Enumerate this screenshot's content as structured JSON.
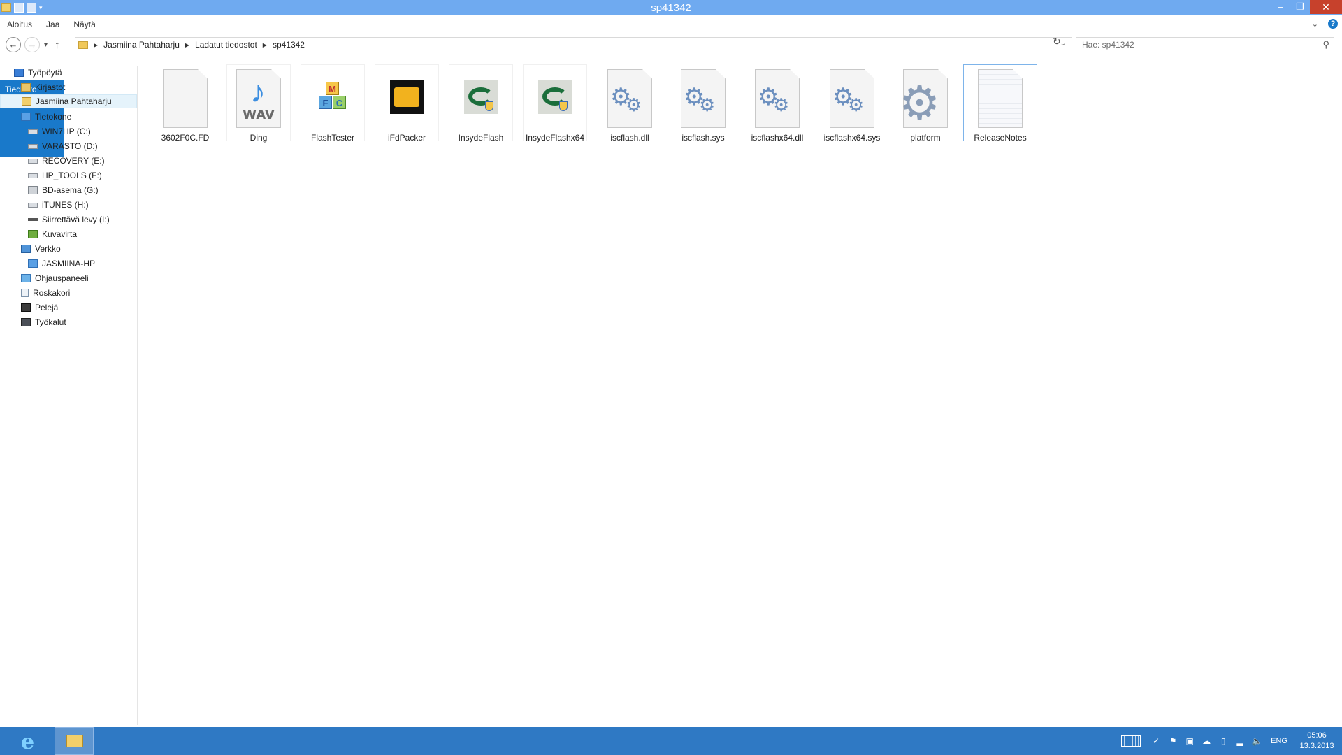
{
  "window": {
    "title": "sp41342"
  },
  "ribbon": {
    "tabs": [
      "Tiedosto",
      "Aloitus",
      "Jaa",
      "Näytä"
    ]
  },
  "address": {
    "crumbs": [
      "Jasmiina Pahtaharju",
      "Ladatut tiedostot",
      "sp41342"
    ]
  },
  "search": {
    "placeholder": "Hae: sp41342"
  },
  "navpane": {
    "items": [
      {
        "label": "Työpöytä",
        "icon": "desktop-icon"
      },
      {
        "label": "Kirjastot",
        "icon": "libraries-icon"
      },
      {
        "label": "Jasmiina Pahtaharju",
        "icon": "user-folder-icon",
        "selected": true
      },
      {
        "label": "Tietokone",
        "icon": "computer-icon"
      },
      {
        "label": "WIN7HP (C:)",
        "icon": "drive-icon"
      },
      {
        "label": "VARASTO (D:)",
        "icon": "drive-icon"
      },
      {
        "label": "RECOVERY (E:)",
        "icon": "drive-icon"
      },
      {
        "label": "HP_TOOLS (F:)",
        "icon": "drive-icon"
      },
      {
        "label": "BD-asema (G:)",
        "icon": "bd-drive-icon"
      },
      {
        "label": "iTUNES (H:)",
        "icon": "drive-icon"
      },
      {
        "label": "Siirrettävä levy (I:)",
        "icon": "removable-drive-icon"
      },
      {
        "label": "Kuvavirta",
        "icon": "photo-stream-icon"
      },
      {
        "label": "Verkko",
        "icon": "network-icon"
      },
      {
        "label": "JASMIINA-HP",
        "icon": "computer-icon"
      },
      {
        "label": "Ohjauspaneeli",
        "icon": "control-panel-icon"
      },
      {
        "label": "Roskakori",
        "icon": "recycle-bin-icon"
      },
      {
        "label": "Pelejä",
        "icon": "games-icon"
      },
      {
        "label": "Työkalut",
        "icon": "tools-icon"
      }
    ]
  },
  "files": [
    {
      "name": "3602F0C.FD",
      "icon": "blank-file-icon"
    },
    {
      "name": "Ding",
      "icon": "wav-file-icon",
      "badge": "WAV"
    },
    {
      "name": "FlashTester",
      "icon": "flashtester-app-icon",
      "letters": [
        "M",
        "F",
        "C"
      ]
    },
    {
      "name": "iFdPacker",
      "icon": "ifdpacker-app-icon"
    },
    {
      "name": "InsydeFlash",
      "icon": "insydeflash-app-icon"
    },
    {
      "name": "InsydeFlashx64",
      "icon": "insydeflash-app-icon"
    },
    {
      "name": "iscflash.dll",
      "icon": "system-file-icon"
    },
    {
      "name": "iscflash.sys",
      "icon": "system-file-icon"
    },
    {
      "name": "iscflashx64.dll",
      "icon": "system-file-icon"
    },
    {
      "name": "iscflashx64.sys",
      "icon": "system-file-icon"
    },
    {
      "name": "platform",
      "icon": "settings-file-icon"
    },
    {
      "name": "ReleaseNotes",
      "icon": "text-file-icon",
      "selected": true
    }
  ],
  "taskbar": {
    "pinned": [
      "internet-explorer-icon",
      "file-explorer-icon"
    ],
    "language": "ENG",
    "time": "05:06",
    "date": "13.3.2013"
  }
}
